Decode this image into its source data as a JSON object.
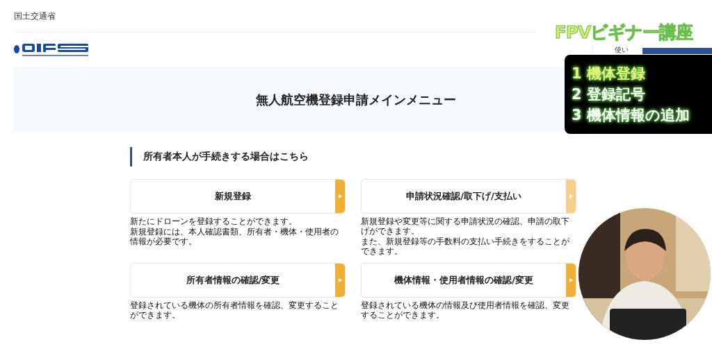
{
  "header": {
    "ministry": "国土交通省",
    "nav": [
      "使い"
    ]
  },
  "hero": {
    "title": "無人航空機登録申請メインメニュー"
  },
  "section": {
    "heading": "所有者本人が手続きする場合はこちら"
  },
  "cards": [
    {
      "title": "新規登録",
      "hovered": false,
      "description": [
        "新たにドローンを登録することができます。",
        "新規登録には、本人確認書類、所有者・機体・使用者の情報が必要です。"
      ]
    },
    {
      "title": "申請状況確認/取下げ/支払い",
      "hovered": true,
      "description": [
        "新規登録や変更等に関する申請状況の確認、申請の取下げができます。",
        "また、新規登録等の手数料の支払い手続きをすることができます。"
      ]
    },
    {
      "title": "所有者情報の確認/変更",
      "hovered": false,
      "description": [
        "登録されている機体の所有者情報を確認、変更することができます。"
      ]
    },
    {
      "title": "機体情報・使用者情報の確認/変更",
      "hovered": false,
      "description": [
        "登録されている機体の情報及び使用者情報を確認、変更することができます。"
      ]
    }
  ],
  "overlay": {
    "banner": "FPVビギナー講座",
    "topics": [
      "1 機体登録",
      "2 登録記号",
      "3 機体情報の追加"
    ],
    "webcam": {
      "kind": "picture"
    }
  }
}
